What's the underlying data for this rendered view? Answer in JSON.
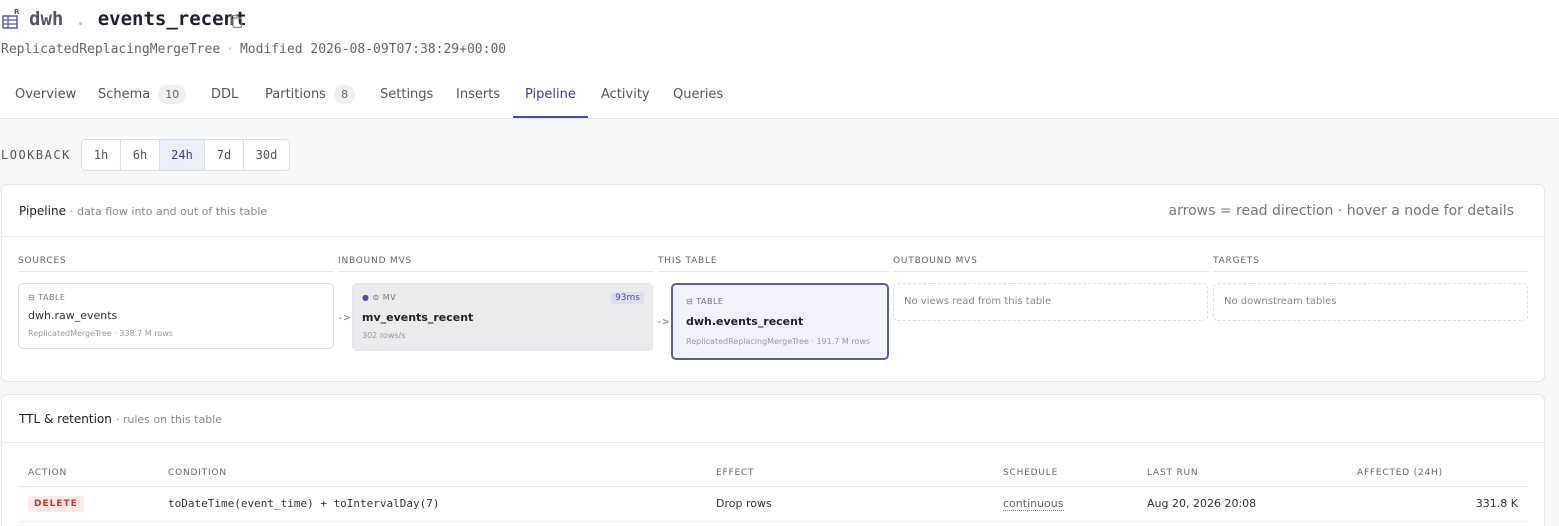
{
  "header": {
    "db": "dwh",
    "dot": ".",
    "table": "events_recent",
    "engine": "ReplicatedReplacingMergeTree",
    "separator": "·",
    "modified": "Modified 2026-08-09T07:38:29+00:00"
  },
  "tabs": [
    {
      "label": "Overview"
    },
    {
      "label": "Schema",
      "count": "10"
    },
    {
      "label": "DDL"
    },
    {
      "label": "Partitions",
      "count": "8"
    },
    {
      "label": "Settings"
    },
    {
      "label": "Inserts"
    },
    {
      "label": "Pipeline",
      "active": true
    },
    {
      "label": "Activity"
    },
    {
      "label": "Queries"
    }
  ],
  "lookback": {
    "label": "LOOKBACK",
    "options": [
      "1h",
      "6h",
      "24h",
      "7d",
      "30d"
    ],
    "selected": "24h"
  },
  "pipeline": {
    "title": "Pipeline",
    "subtitle": "· data flow into and out of this table",
    "hint": "arrows = read direction · hover a node for details",
    "columns": [
      "SOURCES",
      "INBOUND MVS",
      "THIS TABLE",
      "OUTBOUND MVS",
      "TARGETS"
    ],
    "arrow": "->",
    "source": {
      "kind": "TABLE",
      "name": "dwh.raw_events",
      "meta": "ReplicatedMergeTree · 338.7 M rows"
    },
    "mv": {
      "kind": "MV",
      "name": "mv_events_recent",
      "meta": "302 rows/s",
      "latency": "93ms"
    },
    "self": {
      "kind": "TABLE",
      "name": "dwh.events_recent",
      "meta": "ReplicatedReplacingMergeTree · 191.7 M rows"
    },
    "outbound_empty": "No views read from this table",
    "targets_empty": "No downstream tables"
  },
  "ttl": {
    "title": "TTL & retention",
    "subtitle": "· rules on this table",
    "headers": [
      "ACTION",
      "CONDITION",
      "EFFECT",
      "SCHEDULE",
      "LAST RUN",
      "AFFECTED (24H)"
    ],
    "rows": [
      {
        "action": "DELETE",
        "condition": "toDateTime(event_time) + toIntervalDay(7)",
        "effect": "Drop rows",
        "schedule": "continuous",
        "last_run": "Aug 20, 2026 20:08",
        "affected": "331.8 K"
      }
    ]
  },
  "colors": {
    "accent": "#4a4fa8",
    "delete": "#c0392b"
  },
  "icons": {
    "table": "table-icon",
    "copy": "copy-icon",
    "mv": "layers-icon"
  }
}
